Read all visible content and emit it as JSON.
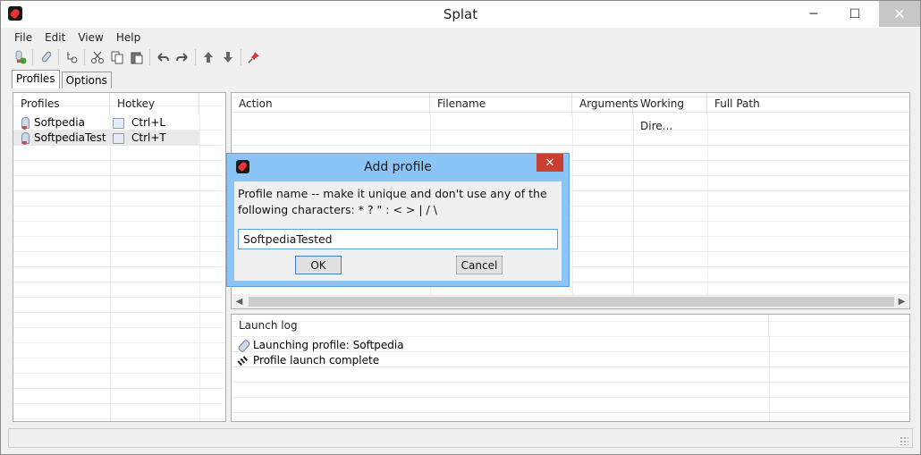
{
  "window": {
    "title": "Splat"
  },
  "caption": {
    "minimize": "─",
    "maximize": "☐",
    "close": "✕"
  },
  "menu": [
    "File",
    "Edit",
    "View",
    "Help"
  ],
  "tabs": [
    "Profiles",
    "Options"
  ],
  "profiles": {
    "headers": [
      "Profiles",
      "Hotkey"
    ],
    "rows": [
      {
        "name": "Softpedia",
        "hotkey": "Ctrl+L"
      },
      {
        "name": "SoftpediaTest",
        "hotkey": "Ctrl+T"
      }
    ]
  },
  "actions": {
    "headers": [
      "Action",
      "Filename",
      "Arguments",
      "Working Dire...",
      "Full Path"
    ]
  },
  "launch_log": {
    "header": "Launch log",
    "entries": [
      "Launching profile: Softpedia",
      "Profile launch complete"
    ]
  },
  "dialog": {
    "title": "Add profile",
    "prompt_line1": "Profile name -- make it unique and don't use any of the",
    "prompt_line2": "following characters:    * ? \" : < > | / \\",
    "input_value": "SoftpediaTested",
    "ok_label": "OK",
    "cancel_label": "Cancel",
    "close": "✕"
  },
  "colors": {
    "dialog_frame": "#8bc4f6",
    "close_red": "#c84031",
    "selection": "#eaeaea"
  }
}
